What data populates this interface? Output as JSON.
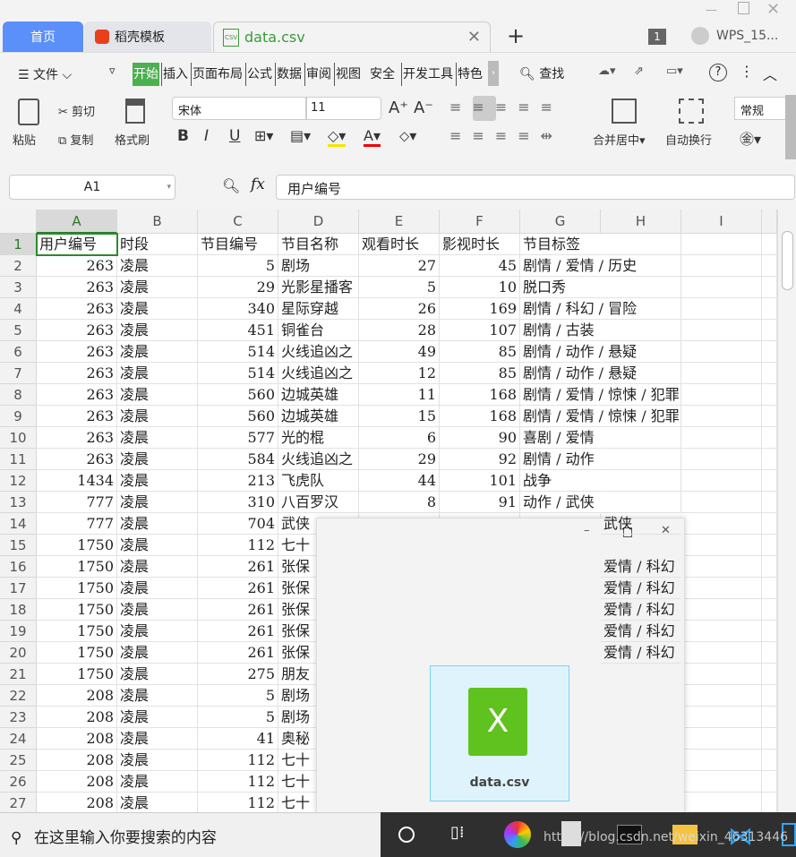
{
  "window": {
    "controls": [
      "minimize",
      "maximize",
      "close"
    ]
  },
  "tabs": [
    {
      "label": "首页"
    },
    {
      "label": "稻壳模板"
    },
    {
      "label": "data.csv"
    }
  ],
  "account": {
    "badge": "1",
    "name": "WPS_15..."
  },
  "menu": {
    "file": "文件",
    "items": [
      "开始",
      "插入",
      "页面布局",
      "公式",
      "数据",
      "审阅",
      "视图",
      "安全",
      "开发工具",
      "特色"
    ],
    "search": "查找"
  },
  "ribbon": {
    "paste": "粘贴",
    "cut": "剪切",
    "copy": "复制",
    "format_painter": "格式刷",
    "font": "宋体",
    "font_size": "11",
    "merge": "合并居中",
    "wrap": "自动换行",
    "number_format": "常规"
  },
  "formula_bar": {
    "cell_ref": "A1",
    "fx": "fx",
    "value": "用户编号"
  },
  "columns": [
    "A",
    "B",
    "C",
    "D",
    "E",
    "F",
    "G",
    "H",
    "I"
  ],
  "rows": [
    [
      "用户编号",
      "时段",
      "节目编号",
      "节目名称",
      "观看时长",
      "影视时长",
      "节目标签"
    ],
    [
      "263",
      "凌晨",
      "5",
      "剧场",
      "27",
      "45",
      "剧情 / 爱情 / 历史"
    ],
    [
      "263",
      "凌晨",
      "29",
      "光影星播客",
      "5",
      "10",
      "脱口秀"
    ],
    [
      "263",
      "凌晨",
      "340",
      "星际穿越",
      "26",
      "169",
      "剧情 / 科幻 / 冒险"
    ],
    [
      "263",
      "凌晨",
      "451",
      "铜雀台",
      "28",
      "107",
      "剧情 / 古装"
    ],
    [
      "263",
      "凌晨",
      "514",
      "火线追凶之",
      "49",
      "85",
      "剧情 / 动作 / 悬疑"
    ],
    [
      "263",
      "凌晨",
      "514",
      "火线追凶之",
      "12",
      "85",
      "剧情 / 动作 / 悬疑"
    ],
    [
      "263",
      "凌晨",
      "560",
      "边城英雄",
      "11",
      "168",
      "剧情 / 爱情 / 惊悚 / 犯罪"
    ],
    [
      "263",
      "凌晨",
      "560",
      "边城英雄",
      "15",
      "168",
      "剧情 / 爱情 / 惊悚 / 犯罪"
    ],
    [
      "263",
      "凌晨",
      "577",
      "光的棍",
      "6",
      "90",
      "喜剧 / 爱情"
    ],
    [
      "263",
      "凌晨",
      "584",
      "火线追凶之",
      "29",
      "92",
      "剧情 / 动作"
    ],
    [
      "1434",
      "凌晨",
      "213",
      "飞虎队",
      "44",
      "101",
      "战争"
    ],
    [
      "777",
      "凌晨",
      "310",
      "八百罗汉",
      "8",
      "91",
      "动作 / 武侠"
    ],
    [
      "777",
      "凌晨",
      "704",
      "武侠",
      "",
      "",
      "",
      "武侠"
    ],
    [
      "1750",
      "凌晨",
      "112",
      "七十",
      "",
      "",
      "",
      ""
    ],
    [
      "1750",
      "凌晨",
      "261",
      "张保",
      "",
      "",
      "",
      "爱情 / 科幻"
    ],
    [
      "1750",
      "凌晨",
      "261",
      "张保",
      "",
      "",
      "",
      "爱情 / 科幻"
    ],
    [
      "1750",
      "凌晨",
      "261",
      "张保",
      "",
      "",
      "",
      "爱情 / 科幻"
    ],
    [
      "1750",
      "凌晨",
      "261",
      "张保",
      "",
      "",
      "",
      "爱情 / 科幻"
    ],
    [
      "1750",
      "凌晨",
      "261",
      "张保",
      "",
      "",
      "",
      "爱情 / 科幻"
    ],
    [
      "1750",
      "凌晨",
      "275",
      "朋友",
      "",
      "",
      "",
      ""
    ],
    [
      "208",
      "凌晨",
      "5",
      "剧场",
      "",
      "",
      "",
      ""
    ],
    [
      "208",
      "凌晨",
      "5",
      "剧场",
      "",
      "",
      "",
      ""
    ],
    [
      "208",
      "凌晨",
      "41",
      "奥秘",
      "",
      "",
      "",
      ""
    ],
    [
      "208",
      "凌晨",
      "112",
      "七十",
      "",
      "",
      "",
      ""
    ],
    [
      "208",
      "凌晨",
      "112",
      "七十",
      "",
      "",
      "",
      ""
    ],
    [
      "208",
      "凌晨",
      "112",
      "七十",
      "",
      "",
      "",
      ""
    ]
  ],
  "popup": {
    "file_label": "data.csv",
    "controls": [
      "minimize",
      "maximize",
      "close"
    ]
  },
  "taskbar": {
    "search_placeholder": "在这里输入你要搜索的内容",
    "watermark": "https://blog.csdn.net/weixin_46313446"
  },
  "colors": {
    "accent_green": "#4caf50",
    "home_tab": "#5b8ff9",
    "excel_green": "#5fc21e"
  }
}
